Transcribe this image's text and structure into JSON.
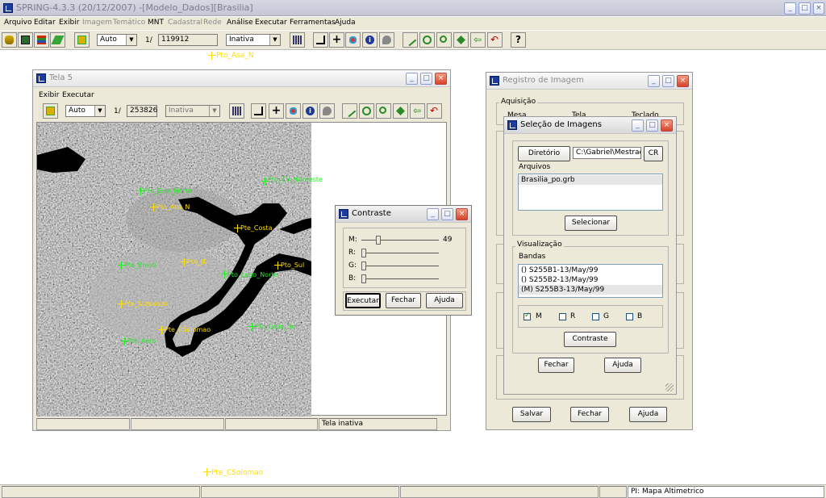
{
  "app": {
    "title": "SPRING-4.3.3 (20/12/2007) -[Modelo_Dados][Brasilia]"
  },
  "menu": [
    {
      "label": "Arquivo",
      "enabled": true
    },
    {
      "label": "Editar",
      "enabled": true
    },
    {
      "label": "Exibir",
      "enabled": true
    },
    {
      "label": "Imagem",
      "enabled": false
    },
    {
      "label": "Temático",
      "enabled": false
    },
    {
      "label": "MNT",
      "enabled": true
    },
    {
      "label": "Cadastral",
      "enabled": false
    },
    {
      "label": "Rede",
      "enabled": false
    },
    {
      "label": "Análise",
      "enabled": true
    },
    {
      "label": "Executar",
      "enabled": true
    },
    {
      "label": "Ferramentas",
      "enabled": true
    },
    {
      "label": "Ajuda",
      "enabled": true
    }
  ],
  "toolbar": {
    "mode_select": "Auto",
    "scale_prefix": "1/",
    "scale_value": "119912",
    "status_select": "Inativa"
  },
  "canvas_labels": {
    "top": "Pto_Asa_N",
    "bottom": "Pte_CSolomao"
  },
  "tela5": {
    "title": "Tela 5",
    "menu": [
      "Exibir",
      "Executar"
    ],
    "mode_select": "Auto",
    "scale_prefix": "1/",
    "scale_value": "253826",
    "status_select": "Inativa",
    "status_bar": [
      "",
      "",
      "",
      "Tela inativa"
    ],
    "map_labels": [
      {
        "text": "Pto_Asa_N",
        "color": "yellow"
      },
      {
        "text": "Pto_CV_Noroeste",
        "color": "green"
      },
      {
        "text": "Pto_Eixo_Norte",
        "color": "green"
      },
      {
        "text": "Pte_Costa",
        "color": "yellow"
      },
      {
        "text": "Pto_Lago_Norte",
        "color": "green"
      },
      {
        "text": "Pte_Brasil",
        "color": "green"
      },
      {
        "text": "Pto_Sul",
        "color": "yellow"
      },
      {
        "text": "Pte_Sudoeste",
        "color": "green"
      },
      {
        "text": "Pte_JK",
        "color": "yellow"
      },
      {
        "text": "Pte_CSolomao",
        "color": "yellow"
      },
      {
        "text": "Pto_Lago_Sul",
        "color": "green"
      },
      {
        "text": "Pto_Aero",
        "color": "green"
      }
    ]
  },
  "contraste": {
    "title": "Contraste",
    "m_label": "M:",
    "m_value": "49",
    "r_label": "R:",
    "g_label": "G:",
    "b_label": "B:",
    "btn_executar": "Executar",
    "btn_fechar": "Fechar",
    "btn_ajuda": "Ajuda"
  },
  "registro": {
    "title": "Registro de Imagem",
    "aquisicao_label": "Aquisição",
    "radio_mesa": "Mesa",
    "radio_tela": "Tela",
    "radio_teclado": "Teclado",
    "btn_salvar": "Salvar",
    "btn_fechar": "Fechar",
    "btn_ajuda": "Ajuda"
  },
  "selecao": {
    "title": "Seleção de Imagens",
    "btn_diretorio": "Diretório",
    "dir_value": "C:\\Gabriel\\Mestrado\\",
    "btn_cr": "CR",
    "arquivos_label": "Arquivos",
    "arquivos": [
      "Brasilia_po.grb"
    ],
    "btn_selecionar": "Selecionar",
    "visualizacao_label": "Visualização",
    "bandas_label": "Bandas",
    "bandas": [
      "() S255B1-13/May/99",
      "() S255B2-13/May/99",
      "(M) S255B3-13/May/99"
    ],
    "check_m": "M",
    "check_r": "R",
    "check_g": "G",
    "check_b": "B",
    "btn_contraste": "Contraste",
    "btn_fechar": "Fechar",
    "btn_ajuda": "Ajuda"
  },
  "statusbar": {
    "right": "PI: Mapa Altimetrico"
  }
}
